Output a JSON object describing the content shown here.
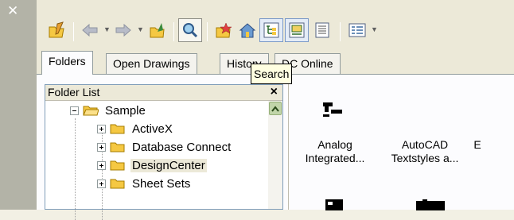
{
  "toolbar": {
    "buttons": [
      {
        "name": "folder-pencil-icon"
      },
      {
        "name": "back-arrow-icon"
      },
      {
        "name": "forward-arrow-icon"
      },
      {
        "name": "up-folder-icon"
      },
      {
        "name": "search-icon"
      },
      {
        "name": "favorites-icon"
      },
      {
        "name": "home-icon"
      },
      {
        "name": "tree-toggle-icon"
      },
      {
        "name": "preview-icon"
      },
      {
        "name": "description-icon"
      },
      {
        "name": "views-icon"
      }
    ]
  },
  "tabs": [
    {
      "label": "Folders",
      "active": true
    },
    {
      "label": "Open Drawings",
      "active": false
    },
    {
      "label": "History",
      "active": false
    },
    {
      "label": "DC Online",
      "active": false
    }
  ],
  "tooltip": {
    "text": "Search"
  },
  "folder_panel": {
    "title": "Folder List",
    "close": "×",
    "tree": [
      {
        "label": "Sample",
        "expander": "minus",
        "level": 0,
        "selected": false
      },
      {
        "label": "ActiveX",
        "expander": "plus",
        "level": 1,
        "selected": false
      },
      {
        "label": "Database Connect",
        "expander": "plus",
        "level": 1,
        "selected": false
      },
      {
        "label": "DesignCenter",
        "expander": "plus",
        "level": 1,
        "selected": true
      },
      {
        "label": "Sheet Sets",
        "expander": "plus",
        "level": 1,
        "selected": false
      }
    ]
  },
  "content_items": [
    {
      "line1": "Analog",
      "line2": "Integrated..."
    },
    {
      "line1": "AutoCAD",
      "line2": "Textstyles a..."
    },
    {
      "line1": "",
      "line2": "E"
    }
  ],
  "colors": {
    "accent": "#7a99c8",
    "folder": "#f5c842",
    "selection": "#ece9d8"
  }
}
